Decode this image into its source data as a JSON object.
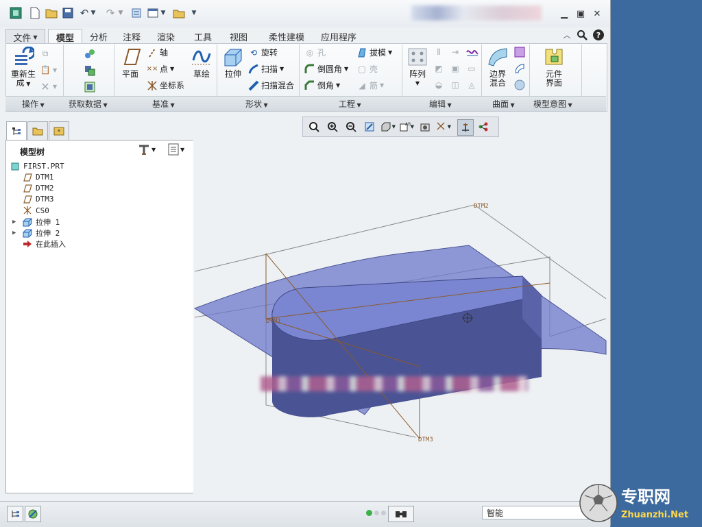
{
  "tabs": [
    "文件",
    "模型",
    "分析",
    "注释",
    "渲染",
    "工具",
    "视图",
    "柔性建模",
    "应用程序"
  ],
  "active_tab": "模型",
  "ribbon": {
    "operations": {
      "regenerate": "重新生成",
      "regenerate_line1": "重新生",
      "regenerate_line2": "成",
      "label": "操作"
    },
    "get_data": {
      "label": "获取数据"
    },
    "datum": {
      "plane": "平面",
      "axis": "轴",
      "point": "点",
      "csys": "坐标系",
      "sketch": "草绘",
      "label": "基准"
    },
    "shapes": {
      "extrude": "拉伸",
      "revolve": "旋转",
      "sweep": "扫描",
      "swept_blend": "扫描混合",
      "label": "形状"
    },
    "engineering": {
      "hole": "孔",
      "round": "倒圆角",
      "chamfer": "倒角",
      "draft": "拔模",
      "shell": "壳",
      "rib": "筋",
      "label": "工程"
    },
    "editing": {
      "pattern": "阵列",
      "label": "编辑"
    },
    "surfaces": {
      "boundary_blend_1": "边界",
      "boundary_blend_2": "混合",
      "label": "曲面"
    },
    "model_intent": {
      "component_interface_1": "元件",
      "component_interface_2": "界面",
      "label": "模型意图"
    }
  },
  "model_tree": {
    "title": "模型树",
    "items": [
      {
        "label": "FIRST.PRT",
        "icon": "part-icon",
        "expandable": false
      },
      {
        "label": "DTM1",
        "icon": "datum-plane-icon",
        "expandable": false
      },
      {
        "label": "DTM2",
        "icon": "datum-plane-icon",
        "expandable": false
      },
      {
        "label": "DTM3",
        "icon": "datum-plane-icon",
        "expandable": false
      },
      {
        "label": "CS0",
        "icon": "csys-icon",
        "expandable": false
      },
      {
        "label": "拉伸 1",
        "icon": "extrude-icon",
        "expandable": true
      },
      {
        "label": "拉伸 2",
        "icon": "extrude-icon",
        "expandable": true
      },
      {
        "label": "在此插入",
        "icon": "insert-here-arrow-icon",
        "expandable": false
      }
    ]
  },
  "viewport": {
    "datum_labels": {
      "dtm1": "DTM1",
      "dtm2": "DTM2",
      "dtm3": "DTM3"
    }
  },
  "status_bar": {
    "selection_filter": "智能"
  },
  "watermark": {
    "brand_cn": "专职网",
    "brand_en": "Zhuanzhi.Net"
  },
  "colors": {
    "surface": "#6e78cc",
    "solid_top": "#7a86d2",
    "solid_side": "#4a5394",
    "datum_plane": "#8a5a2a",
    "desktop": "#3d6a9e"
  }
}
